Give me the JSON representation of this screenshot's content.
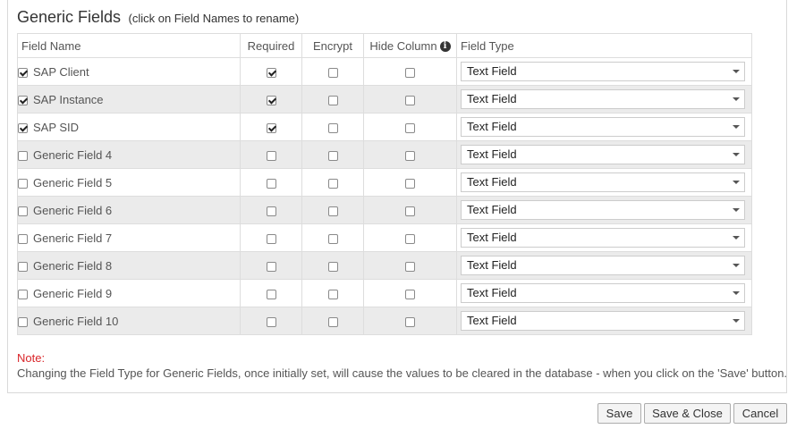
{
  "section": {
    "title": "Generic Fields",
    "subtitle": "(click on Field Names to rename)"
  },
  "table": {
    "headers": {
      "field_name": "Field Name",
      "required": "Required",
      "encrypt": "Encrypt",
      "hide_column": "Hide Column",
      "field_type": "Field Type"
    },
    "rows": [
      {
        "enabled": true,
        "name": "SAP Client",
        "required": true,
        "encrypt": false,
        "hide": false,
        "type": "Text Field"
      },
      {
        "enabled": true,
        "name": "SAP Instance",
        "required": true,
        "encrypt": false,
        "hide": false,
        "type": "Text Field"
      },
      {
        "enabled": true,
        "name": "SAP SID",
        "required": true,
        "encrypt": false,
        "hide": false,
        "type": "Text Field"
      },
      {
        "enabled": false,
        "name": "Generic Field 4",
        "required": false,
        "encrypt": false,
        "hide": false,
        "type": "Text Field"
      },
      {
        "enabled": false,
        "name": "Generic Field 5",
        "required": false,
        "encrypt": false,
        "hide": false,
        "type": "Text Field"
      },
      {
        "enabled": false,
        "name": "Generic Field 6",
        "required": false,
        "encrypt": false,
        "hide": false,
        "type": "Text Field"
      },
      {
        "enabled": false,
        "name": "Generic Field 7",
        "required": false,
        "encrypt": false,
        "hide": false,
        "type": "Text Field"
      },
      {
        "enabled": false,
        "name": "Generic Field 8",
        "required": false,
        "encrypt": false,
        "hide": false,
        "type": "Text Field"
      },
      {
        "enabled": false,
        "name": "Generic Field 9",
        "required": false,
        "encrypt": false,
        "hide": false,
        "type": "Text Field"
      },
      {
        "enabled": false,
        "name": "Generic Field 10",
        "required": false,
        "encrypt": false,
        "hide": false,
        "type": "Text Field"
      }
    ]
  },
  "note": {
    "label": "Note:",
    "text": "Changing the Field Type for Generic Fields, once initially set, will cause the values to be cleared in the database - when you click on the 'Save' button."
  },
  "buttons": {
    "save": "Save",
    "save_close": "Save & Close",
    "cancel": "Cancel"
  },
  "icons": {
    "hide_column_info": "info-icon"
  },
  "colors": {
    "note_label": "#d9262a",
    "alt_row": "#ebebeb"
  }
}
